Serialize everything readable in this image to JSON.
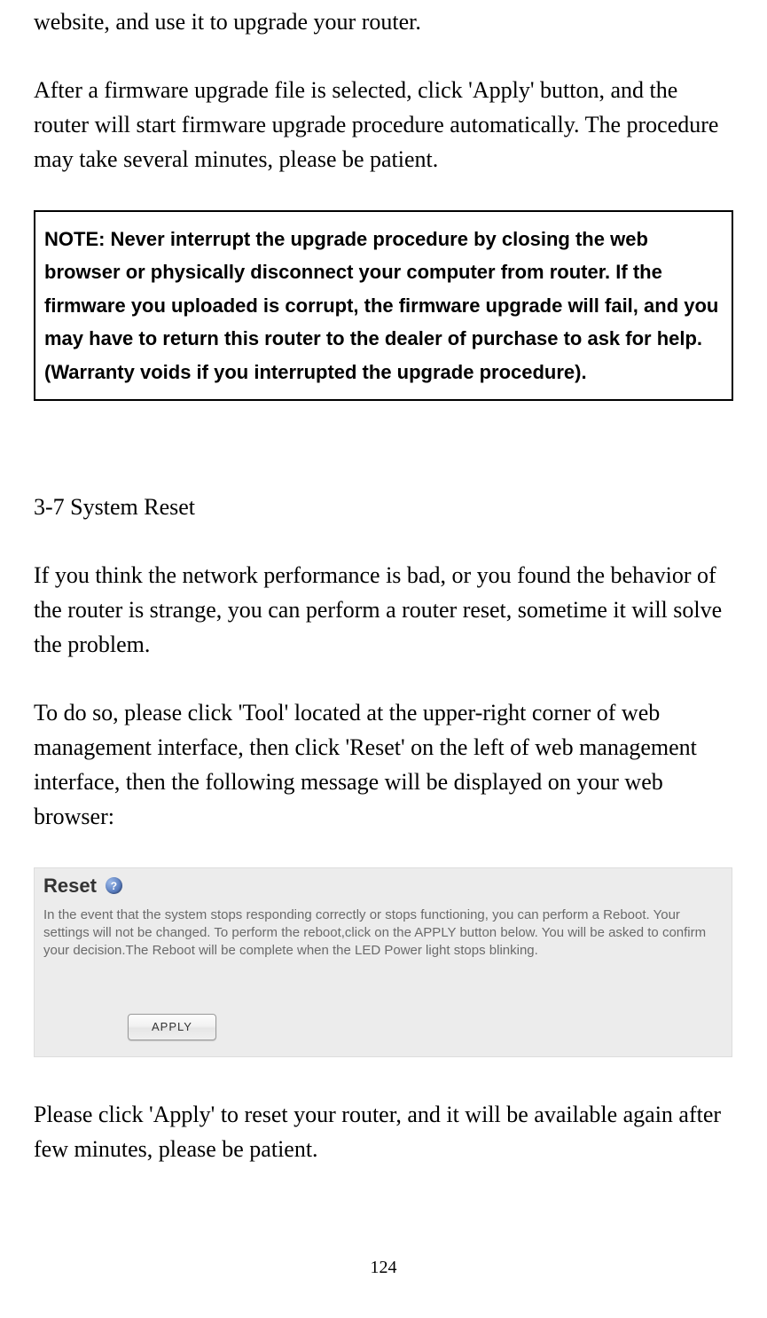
{
  "intro_fragment": "website, and use it to upgrade your router.",
  "para1": "After a firmware upgrade file is selected, click 'Apply' button, and the router will start firmware upgrade procedure automatically. The procedure may take several minutes, please be patient.",
  "note": "NOTE: Never interrupt the upgrade procedure by closing the web browser or physically disconnect your computer from router. If the firmware you uploaded is corrupt, the firmware upgrade will fail, and you may have to return this router to the dealer of purchase to ask for help. (Warranty voids if you interrupted the upgrade procedure).",
  "section_heading": "3-7 System Reset",
  "para2": "If you think the network performance is bad, or you found the behavior of the router is strange, you can perform a router reset, sometime it will solve the problem.",
  "para3": "To do so, please click 'Tool' located at the upper-right corner of web management interface, then click 'Reset' on the left of web management interface, then the following message will be displayed on your web browser:",
  "screenshot": {
    "title": "Reset",
    "desc": "In the event that the system stops responding correctly or stops functioning, you can perform a Reboot. Your settings will not be changed. To perform the reboot,click on the APPLY button below. You will be asked to confirm your decision.The Reboot will be complete when the LED Power light stops blinking.",
    "apply_label": "APPLY"
  },
  "para4": "Please click 'Apply' to reset your router, and it will be available again after few minutes, please be patient.",
  "page_number": "124"
}
